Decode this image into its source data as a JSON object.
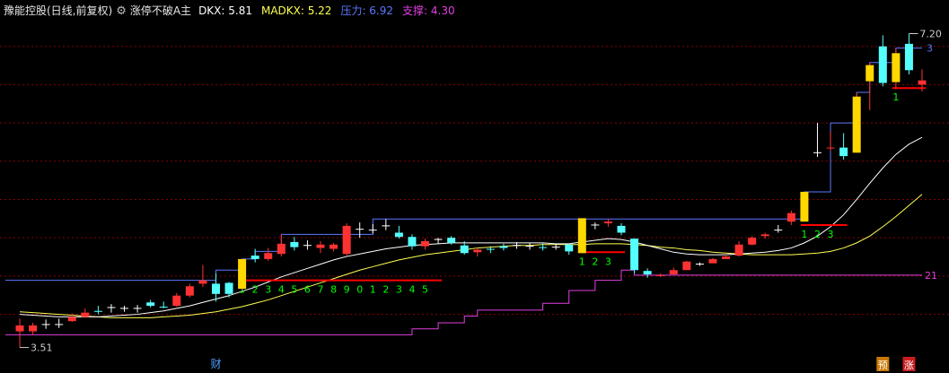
{
  "header": {
    "stock": "豫能控股(日线,前复权)",
    "indicator": "涨停不破A主",
    "gear_icon": "settings-gear-icon",
    "dkx_label": "DKX: 5.81",
    "madkx_label": "MADKX: 5.22",
    "pressure_label": "压力: 6.92",
    "support_label": "支撑: 4.30"
  },
  "colors": {
    "up": "#ff3232",
    "down": "#54ffff",
    "limit": "#ffd800",
    "dkx": "#ffffff",
    "madkx": "#ffff50",
    "pressure": "#5b78ff",
    "support": "#e040e0",
    "count": "#00ff00",
    "count_line": "#ff0000",
    "grid": "#8a0000"
  },
  "chart_data": {
    "type": "candlestick",
    "ylim": [
      3.4,
      7.3
    ],
    "gridlines": [
      7.05,
      6.6,
      6.15,
      5.7,
      5.25,
      4.8,
      4.35,
      3.9
    ],
    "candles": [
      {
        "o": 3.77,
        "h": 3.85,
        "l": 3.51,
        "c": 3.7,
        "k": "up"
      },
      {
        "o": 3.7,
        "h": 3.8,
        "l": 3.66,
        "c": 3.77,
        "k": "up"
      },
      {
        "o": 3.77,
        "h": 3.84,
        "l": 3.73,
        "c": 3.78,
        "k": "cross"
      },
      {
        "o": 3.79,
        "h": 3.85,
        "l": 3.74,
        "c": 3.78,
        "k": "cross"
      },
      {
        "o": 3.82,
        "h": 3.91,
        "l": 3.81,
        "c": 3.87,
        "k": "up"
      },
      {
        "o": 3.87,
        "h": 3.97,
        "l": 3.86,
        "c": 3.92,
        "k": "up"
      },
      {
        "o": 3.93,
        "h": 4.0,
        "l": 3.9,
        "c": 3.94,
        "k": "down"
      },
      {
        "o": 3.95,
        "h": 4.02,
        "l": 3.92,
        "c": 3.98,
        "k": "cross"
      },
      {
        "o": 3.95,
        "h": 4.0,
        "l": 3.93,
        "c": 3.97,
        "k": "cross"
      },
      {
        "o": 3.94,
        "h": 4.01,
        "l": 3.92,
        "c": 3.97,
        "k": "cross"
      },
      {
        "o": 4.0,
        "h": 4.07,
        "l": 3.98,
        "c": 4.04,
        "k": "down"
      },
      {
        "o": 3.99,
        "h": 4.05,
        "l": 3.97,
        "c": 3.99,
        "k": "down"
      },
      {
        "o": 4.0,
        "h": 4.15,
        "l": 3.99,
        "c": 4.12,
        "k": "up"
      },
      {
        "o": 4.12,
        "h": 4.26,
        "l": 4.1,
        "c": 4.23,
        "k": "up"
      },
      {
        "o": 4.26,
        "h": 4.48,
        "l": 4.22,
        "c": 4.3,
        "k": "up"
      },
      {
        "o": 4.26,
        "h": 4.38,
        "l": 4.05,
        "c": 4.14,
        "k": "down"
      },
      {
        "o": 4.14,
        "h": 4.28,
        "l": 4.1,
        "c": 4.27,
        "k": "down"
      },
      {
        "o": 4.2,
        "h": 4.55,
        "l": 4.19,
        "c": 4.55,
        "k": "limit"
      },
      {
        "o": 4.55,
        "h": 4.67,
        "l": 4.51,
        "c": 4.59,
        "k": "down"
      },
      {
        "o": 4.55,
        "h": 4.68,
        "l": 4.53,
        "c": 4.62,
        "k": "up"
      },
      {
        "o": 4.61,
        "h": 4.84,
        "l": 4.58,
        "c": 4.73,
        "k": "up"
      },
      {
        "o": 4.75,
        "h": 4.81,
        "l": 4.65,
        "c": 4.69,
        "k": "down"
      },
      {
        "o": 4.71,
        "h": 4.77,
        "l": 4.66,
        "c": 4.71,
        "k": "cross"
      },
      {
        "o": 4.68,
        "h": 4.76,
        "l": 4.62,
        "c": 4.72,
        "k": "up"
      },
      {
        "o": 4.67,
        "h": 4.74,
        "l": 4.64,
        "c": 4.72,
        "k": "up"
      },
      {
        "o": 4.61,
        "h": 4.97,
        "l": 4.59,
        "c": 4.94,
        "k": "up"
      },
      {
        "o": 4.82,
        "h": 4.98,
        "l": 4.8,
        "c": 4.9,
        "k": "cross"
      },
      {
        "o": 4.89,
        "h": 4.96,
        "l": 4.85,
        "c": 4.89,
        "k": "cross"
      },
      {
        "o": 4.96,
        "h": 5.02,
        "l": 4.89,
        "c": 4.94,
        "k": "cross"
      },
      {
        "o": 4.86,
        "h": 4.94,
        "l": 4.79,
        "c": 4.81,
        "k": "down"
      },
      {
        "o": 4.81,
        "h": 4.84,
        "l": 4.66,
        "c": 4.7,
        "k": "down"
      },
      {
        "o": 4.7,
        "h": 4.79,
        "l": 4.66,
        "c": 4.76,
        "k": "up"
      },
      {
        "o": 4.76,
        "h": 4.8,
        "l": 4.73,
        "c": 4.78,
        "k": "cross"
      },
      {
        "o": 4.8,
        "h": 4.82,
        "l": 4.72,
        "c": 4.74,
        "k": "down"
      },
      {
        "o": 4.71,
        "h": 4.76,
        "l": 4.6,
        "c": 4.62,
        "k": "down"
      },
      {
        "o": 4.63,
        "h": 4.68,
        "l": 4.58,
        "c": 4.66,
        "k": "up"
      },
      {
        "o": 4.66,
        "h": 4.7,
        "l": 4.62,
        "c": 4.67,
        "k": "down"
      },
      {
        "o": 4.68,
        "h": 4.73,
        "l": 4.65,
        "c": 4.7,
        "k": "down"
      },
      {
        "o": 4.71,
        "h": 4.75,
        "l": 4.67,
        "c": 4.71,
        "k": "cross"
      },
      {
        "o": 4.7,
        "h": 4.74,
        "l": 4.66,
        "c": 4.7,
        "k": "cross"
      },
      {
        "o": 4.69,
        "h": 4.74,
        "l": 4.65,
        "c": 4.68,
        "k": "down"
      },
      {
        "o": 4.69,
        "h": 4.73,
        "l": 4.66,
        "c": 4.69,
        "k": "cross"
      },
      {
        "o": 4.72,
        "h": 4.73,
        "l": 4.6,
        "c": 4.64,
        "k": "down"
      },
      {
        "o": 4.62,
        "h": 5.03,
        "l": 4.62,
        "c": 5.03,
        "k": "limit"
      },
      {
        "o": 4.94,
        "h": 4.98,
        "l": 4.9,
        "c": 4.95,
        "k": "cross"
      },
      {
        "o": 4.97,
        "h": 5.02,
        "l": 4.93,
        "c": 4.99,
        "k": "up"
      },
      {
        "o": 4.94,
        "h": 4.97,
        "l": 4.83,
        "c": 4.86,
        "k": "down"
      },
      {
        "o": 4.79,
        "h": 4.79,
        "l": 4.38,
        "c": 4.42,
        "k": "down"
      },
      {
        "o": 4.41,
        "h": 4.44,
        "l": 4.33,
        "c": 4.37,
        "k": "down"
      },
      {
        "o": 4.35,
        "h": 4.38,
        "l": 4.34,
        "c": 4.36,
        "k": "up"
      },
      {
        "o": 4.37,
        "h": 4.45,
        "l": 4.37,
        "c": 4.42,
        "k": "up"
      },
      {
        "o": 4.42,
        "h": 4.53,
        "l": 4.42,
        "c": 4.52,
        "k": "up"
      },
      {
        "o": 4.49,
        "h": 4.51,
        "l": 4.47,
        "c": 4.49,
        "k": "cross"
      },
      {
        "o": 4.5,
        "h": 4.56,
        "l": 4.5,
        "c": 4.55,
        "k": "up"
      },
      {
        "o": 4.55,
        "h": 4.61,
        "l": 4.55,
        "c": 4.58,
        "k": "up"
      },
      {
        "o": 4.59,
        "h": 4.76,
        "l": 4.58,
        "c": 4.72,
        "k": "up"
      },
      {
        "o": 4.72,
        "h": 4.82,
        "l": 4.71,
        "c": 4.8,
        "k": "up"
      },
      {
        "o": 4.82,
        "h": 4.86,
        "l": 4.79,
        "c": 4.84,
        "k": "up"
      },
      {
        "o": 4.89,
        "h": 4.95,
        "l": 4.86,
        "c": 4.89,
        "k": "cross"
      },
      {
        "o": 4.99,
        "h": 5.12,
        "l": 4.95,
        "c": 5.09,
        "k": "up"
      },
      {
        "o": 4.99,
        "h": 5.34,
        "l": 4.99,
        "c": 5.34,
        "k": "limit"
      },
      {
        "o": 5.78,
        "h": 6.15,
        "l": 5.75,
        "c": 5.8,
        "k": "cross"
      },
      {
        "o": 5.85,
        "h": 6.05,
        "l": 5.82,
        "c": 5.86,
        "k": "up"
      },
      {
        "o": 5.86,
        "h": 6.03,
        "l": 5.72,
        "c": 5.76,
        "k": "down"
      },
      {
        "o": 5.8,
        "h": 6.51,
        "l": 5.8,
        "c": 6.46,
        "k": "limit"
      },
      {
        "o": 6.64,
        "h": 6.86,
        "l": 6.3,
        "c": 6.83,
        "k": "limit"
      },
      {
        "o": 7.05,
        "h": 7.18,
        "l": 6.58,
        "c": 6.62,
        "k": "down"
      },
      {
        "o": 6.63,
        "h": 7.03,
        "l": 6.55,
        "c": 6.97,
        "k": "limit"
      },
      {
        "o": 6.77,
        "h": 7.2,
        "l": 6.72,
        "c": 7.08,
        "k": "down"
      },
      {
        "o": 6.65,
        "h": 6.78,
        "l": 6.52,
        "c": 6.6,
        "k": "up"
      }
    ],
    "dkx": [
      3.9,
      3.89,
      3.88,
      3.87,
      3.87,
      3.87,
      3.87,
      3.88,
      3.89,
      3.9,
      3.92,
      3.94,
      3.97,
      4.0,
      4.04,
      4.08,
      4.12,
      4.17,
      4.22,
      4.28,
      4.34,
      4.39,
      4.44,
      4.49,
      4.54,
      4.58,
      4.61,
      4.64,
      4.67,
      4.69,
      4.71,
      4.72,
      4.73,
      4.74,
      4.74,
      4.74,
      4.74,
      4.74,
      4.74,
      4.74,
      4.74,
      4.73,
      4.73,
      4.75,
      4.77,
      4.79,
      4.78,
      4.75,
      4.71,
      4.67,
      4.63,
      4.61,
      4.6,
      4.6,
      4.6,
      4.61,
      4.62,
      4.63,
      4.65,
      4.68,
      4.74,
      4.82,
      4.93,
      5.07,
      5.25,
      5.44,
      5.62,
      5.78,
      5.9,
      5.98
    ],
    "madkx": [
      3.93,
      3.92,
      3.91,
      3.9,
      3.89,
      3.88,
      3.87,
      3.86,
      3.86,
      3.86,
      3.86,
      3.87,
      3.88,
      3.89,
      3.91,
      3.93,
      3.96,
      3.99,
      4.03,
      4.07,
      4.12,
      4.17,
      4.22,
      4.27,
      4.32,
      4.37,
      4.42,
      4.46,
      4.5,
      4.54,
      4.57,
      4.6,
      4.62,
      4.64,
      4.66,
      4.68,
      4.69,
      4.7,
      4.71,
      4.71,
      4.72,
      4.72,
      4.72,
      4.72,
      4.73,
      4.73,
      4.73,
      4.72,
      4.71,
      4.69,
      4.68,
      4.66,
      4.65,
      4.63,
      4.62,
      4.61,
      4.6,
      4.6,
      4.6,
      4.6,
      4.61,
      4.62,
      4.64,
      4.68,
      4.74,
      4.82,
      4.93,
      5.05,
      5.18,
      5.31
    ],
    "pressure_steps": [
      [
        0,
        4.3
      ],
      [
        14,
        4.3
      ],
      [
        15,
        4.42
      ],
      [
        16,
        4.42
      ],
      [
        17,
        4.55
      ],
      [
        18,
        4.64
      ],
      [
        20,
        4.84
      ],
      [
        27,
        5.02
      ],
      [
        43,
        5.02
      ],
      [
        60,
        5.34
      ],
      [
        62,
        6.15
      ],
      [
        64,
        6.51
      ],
      [
        65,
        6.86
      ],
      [
        66,
        6.86
      ],
      [
        67,
        7.03
      ],
      [
        69,
        7.03
      ]
    ],
    "support_steps": [
      [
        0,
        3.66
      ],
      [
        28,
        3.66
      ],
      [
        30,
        3.73
      ],
      [
        32,
        3.8
      ],
      [
        34,
        3.88
      ],
      [
        35,
        3.95
      ],
      [
        40,
        4.03
      ],
      [
        42,
        4.18
      ],
      [
        44,
        4.3
      ],
      [
        46,
        4.42
      ],
      [
        47,
        4.36
      ],
      [
        69,
        4.36
      ]
    ],
    "count_segments": [
      {
        "from": 17,
        "to": 32,
        "y": 4.3,
        "labels": [
          "1",
          "2",
          "3",
          "4",
          "5",
          "6",
          "7",
          "8",
          "9",
          "0",
          "1",
          "2",
          "3",
          "4",
          "5"
        ]
      },
      {
        "from": 43,
        "to": 46,
        "y": 4.63,
        "labels": [
          "1",
          "2",
          "3"
        ]
      },
      {
        "from": 60,
        "to": 63,
        "y": 4.95,
        "labels": [
          "1",
          "2",
          "3"
        ]
      },
      {
        "from": 67,
        "to": 69,
        "y": 6.56,
        "labels": [
          "1"
        ]
      }
    ],
    "right_labels": {
      "pressure": "3",
      "support": "21"
    },
    "annotations": {
      "high": "7.20",
      "low": "3.51"
    },
    "markers": [
      {
        "text": "财",
        "index": 15
      },
      {
        "text": "预",
        "index": 66
      },
      {
        "text": "涨",
        "index": 68
      }
    ]
  }
}
